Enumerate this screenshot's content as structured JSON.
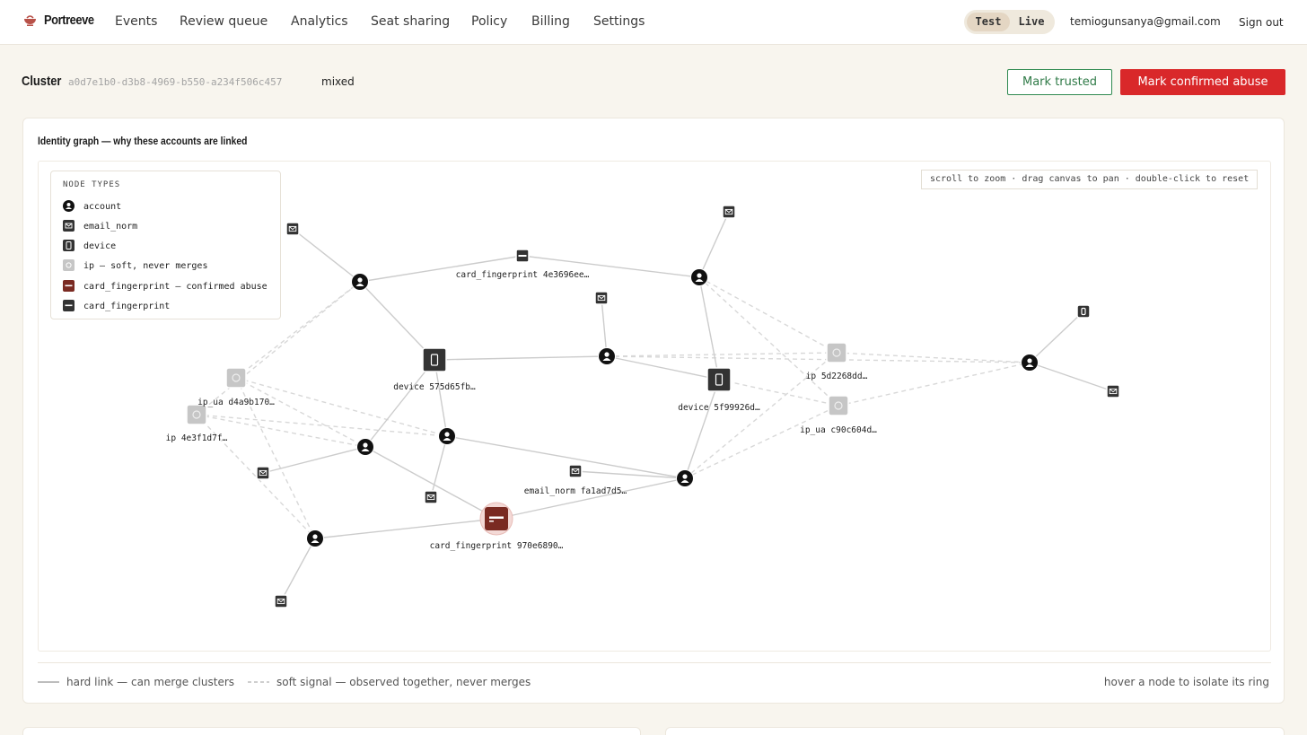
{
  "brand": {
    "name": "Portreeve",
    "logo_icon": "bowl-logo-icon"
  },
  "nav": {
    "items": [
      "Events",
      "Review queue",
      "Analytics",
      "Seat sharing",
      "Policy",
      "Billing",
      "Settings"
    ],
    "mode": {
      "options": [
        "Test",
        "Live"
      ],
      "active": "Test"
    },
    "user_email": "temiogunsanya@gmail.com",
    "signout_label": "Sign out"
  },
  "cluster": {
    "label": "Cluster",
    "id": "a0d7e1b0-d3b8-4969-b550-a234f506c457",
    "verdict": "mixed"
  },
  "actions": {
    "trusted_label": "Mark trusted",
    "abuse_label": "Mark confirmed abuse"
  },
  "graph": {
    "title": "Identity graph — why these accounts are linked",
    "hint": "scroll to zoom · drag canvas to pan · double-click to reset",
    "legend": {
      "heading": "NODE TYPES",
      "items": [
        {
          "type": "account",
          "label": "account"
        },
        {
          "type": "email",
          "label": "email_norm"
        },
        {
          "type": "device",
          "label": "device"
        },
        {
          "type": "ip",
          "label": "ip — soft, never merges"
        },
        {
          "type": "card_abuse",
          "label": "card_fingerprint — confirmed abuse"
        },
        {
          "type": "card",
          "label": "card_fingerprint"
        }
      ]
    },
    "node_labels": {
      "card1": "card_fingerprint 4e3696ee…",
      "dev1": "device 575d65fb…",
      "dev2": "device 5f99926d…",
      "ipua1": "ip_ua d4a9b170…",
      "ip1": "ip 4e3f1d7f…",
      "ip2": "ip 5d2268dd…",
      "ipua2": "ip_ua c90c604d…",
      "email1": "email_norm fa1ad7d5…",
      "cardAbuse": "card_fingerprint 970e6890…"
    },
    "colors": {
      "account": "#111111",
      "email": "#333333",
      "device": "#333333",
      "ip": "#c6c6c6",
      "card_abuse": "#7a2a22",
      "card": "#333333",
      "hard_edge": "#cccccc",
      "soft_edge": "#d8d8d8"
    },
    "footer": {
      "hard_label": "hard link — can merge clusters",
      "soft_label": "soft signal — observed together, never merges",
      "hover_hint": "hover a node to isolate its ring"
    }
  }
}
